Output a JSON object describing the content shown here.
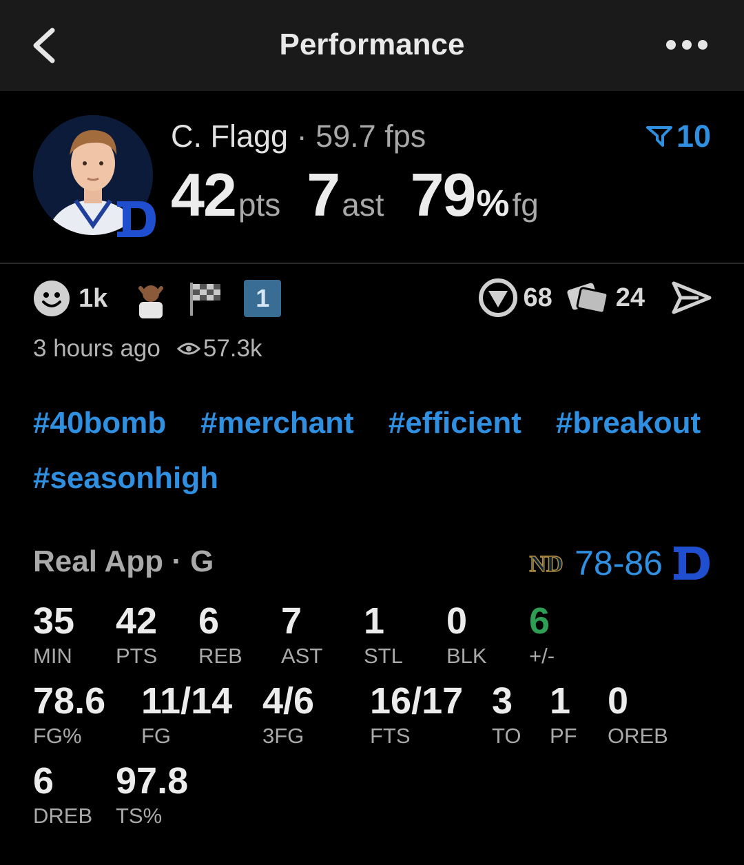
{
  "header": {
    "title": "Performance",
    "back_icon": "chevron-left-icon",
    "more_icon": "ellipsis-icon"
  },
  "player": {
    "name": "C. Flagg",
    "separator": "·",
    "fps": "59.7 fps",
    "rank": "10",
    "rank_icon": "filter-icon",
    "team_logo": "duke-d-logo",
    "stats": [
      {
        "value": "42",
        "unit": "pts"
      },
      {
        "value": "7",
        "unit": "ast"
      },
      {
        "value": "79",
        "pct": "%",
        "unit": "fg"
      }
    ]
  },
  "reactions": {
    "smile_count": "1k",
    "badge_number": "1"
  },
  "actions": {
    "comments_count": "68",
    "cards_count": "24"
  },
  "meta": {
    "time": "3 hours ago",
    "views": "57.3k"
  },
  "tags": [
    "#40bomb",
    "#merchant",
    "#efficient",
    "#breakout",
    "#seasonhigh"
  ],
  "game": {
    "label": "Real App · G",
    "score": "78-86",
    "opponent_logo": "notre-dame-logo"
  },
  "box": {
    "row1": [
      {
        "value": "35",
        "label": "MIN"
      },
      {
        "value": "42",
        "label": "PTS"
      },
      {
        "value": "6",
        "label": "REB"
      },
      {
        "value": "7",
        "label": "AST"
      },
      {
        "value": "1",
        "label": "STL"
      },
      {
        "value": "0",
        "label": "BLK"
      },
      {
        "value": "6",
        "label": "+/-"
      }
    ],
    "row2": [
      {
        "value": "78.6",
        "label": "FG%"
      },
      {
        "value": "11/14",
        "label": "FG"
      },
      {
        "value": "4/6",
        "label": "3FG"
      },
      {
        "value": "16/17",
        "label": "FTS"
      },
      {
        "value": "3",
        "label": "TO"
      },
      {
        "value": "1",
        "label": "PF"
      },
      {
        "value": "0",
        "label": "OREB"
      }
    ],
    "row3": [
      {
        "value": "6",
        "label": "DREB"
      },
      {
        "value": "97.8",
        "label": "TS%"
      }
    ]
  },
  "colors": {
    "accent": "#2f8fe0",
    "positive": "#2e9e55",
    "background": "#000000",
    "header_bg": "#1a1a1a"
  }
}
